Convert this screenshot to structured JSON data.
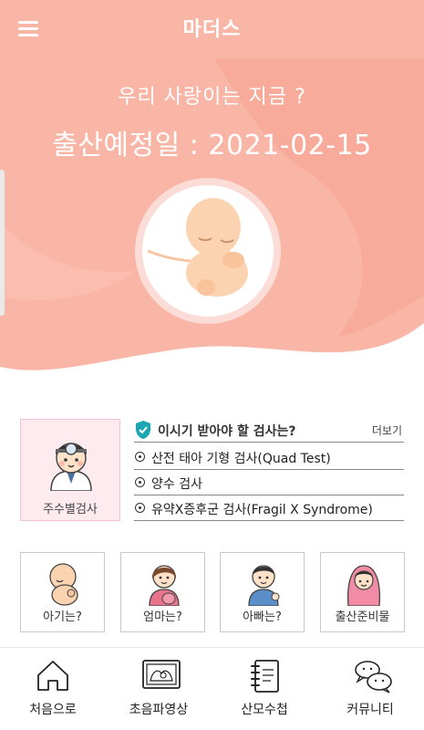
{
  "header": {
    "title": "마더스",
    "menu_icon": "hamburger-menu-icon",
    "color": "#f9b5a6"
  },
  "hero": {
    "question": "우리 사랑이는 지금 ?",
    "due_date_text": "출산예정일 : 2021-02-15",
    "fetus_icon": "fetus-illustration",
    "colors": {
      "pink": "#f9b5a6",
      "coral": "#f7a392"
    }
  },
  "checkups": {
    "weekly_label": "주수별검사",
    "weekly_icon": "doctor-icon",
    "header_icon": "shield-check-icon",
    "title": "이시기 받아야 할 검사는?",
    "more": "더보기",
    "items": [
      {
        "text": "산전 태아 기형 검사(Quad Test)"
      },
      {
        "text": "양수 검사"
      },
      {
        "text": "유약X증후군 검사(Fragil X Syndrome)"
      }
    ]
  },
  "cards": [
    {
      "label": "아기는?",
      "icon": "baby-icon"
    },
    {
      "label": "엄마는?",
      "icon": "mother-icon"
    },
    {
      "label": "아빠는?",
      "icon": "father-icon"
    },
    {
      "label": "출산준비물",
      "icon": "newborn-swaddle-icon"
    }
  ],
  "bottom_nav": [
    {
      "label": "처음으로",
      "icon": "home-icon"
    },
    {
      "label": "초음파영상",
      "icon": "ultrasound-icon"
    },
    {
      "label": "산모수첩",
      "icon": "notebook-icon"
    },
    {
      "label": "커뮤니티",
      "icon": "chat-bubbles-icon"
    }
  ]
}
